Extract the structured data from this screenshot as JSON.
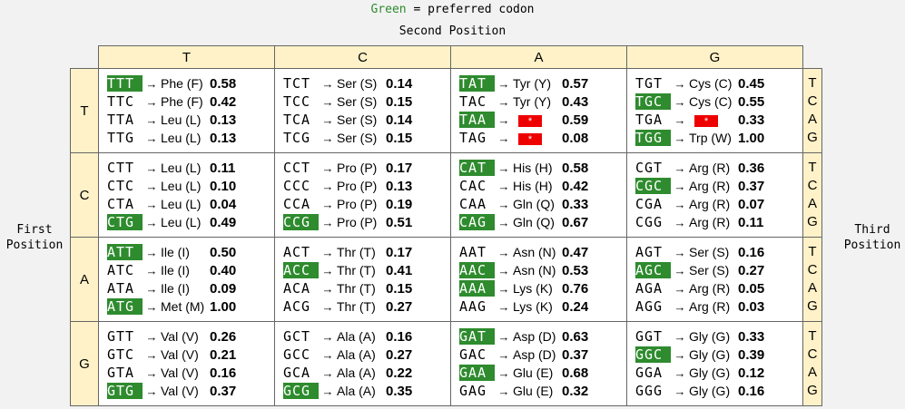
{
  "legend": {
    "green_word": "Green",
    "rest": " = preferred codon"
  },
  "second_position_label": "Second Position",
  "first_position_label": "First Position",
  "third_position_label": "Third Position",
  "columns": [
    "T",
    "C",
    "A",
    "G"
  ],
  "third_letters": [
    "T",
    "C",
    "A",
    "G"
  ],
  "rows": [
    {
      "label": "T",
      "cells": [
        [
          {
            "codon": "TTT",
            "aa": "Phe (F)",
            "freq": "0.58",
            "pref": true
          },
          {
            "codon": "TTC",
            "aa": "Phe (F)",
            "freq": "0.42",
            "pref": false
          },
          {
            "codon": "TTA",
            "aa": "Leu (L)",
            "freq": "0.13",
            "pref": false
          },
          {
            "codon": "TTG",
            "aa": "Leu (L)",
            "freq": "0.13",
            "pref": false
          }
        ],
        [
          {
            "codon": "TCT",
            "aa": "Ser (S)",
            "freq": "0.14",
            "pref": false
          },
          {
            "codon": "TCC",
            "aa": "Ser (S)",
            "freq": "0.15",
            "pref": false
          },
          {
            "codon": "TCA",
            "aa": "Ser (S)",
            "freq": "0.14",
            "pref": false
          },
          {
            "codon": "TCG",
            "aa": "Ser (S)",
            "freq": "0.15",
            "pref": false
          }
        ],
        [
          {
            "codon": "TAT",
            "aa": "Tyr (Y)",
            "freq": "0.57",
            "pref": true
          },
          {
            "codon": "TAC",
            "aa": "Tyr (Y)",
            "freq": "0.43",
            "pref": false
          },
          {
            "codon": "TAA",
            "aa": "*",
            "freq": "0.59",
            "pref": true,
            "stop": true
          },
          {
            "codon": "TAG",
            "aa": "*",
            "freq": "0.08",
            "pref": false,
            "stop": true
          }
        ],
        [
          {
            "codon": "TGT",
            "aa": "Cys (C)",
            "freq": "0.45",
            "pref": false
          },
          {
            "codon": "TGC",
            "aa": "Cys (C)",
            "freq": "0.55",
            "pref": true
          },
          {
            "codon": "TGA",
            "aa": "*",
            "freq": "0.33",
            "pref": false,
            "stop": true
          },
          {
            "codon": "TGG",
            "aa": "Trp (W)",
            "freq": "1.00",
            "pref": true
          }
        ]
      ]
    },
    {
      "label": "C",
      "cells": [
        [
          {
            "codon": "CTT",
            "aa": "Leu (L)",
            "freq": "0.11",
            "pref": false
          },
          {
            "codon": "CTC",
            "aa": "Leu (L)",
            "freq": "0.10",
            "pref": false
          },
          {
            "codon": "CTA",
            "aa": "Leu (L)",
            "freq": "0.04",
            "pref": false
          },
          {
            "codon": "CTG",
            "aa": "Leu (L)",
            "freq": "0.49",
            "pref": true
          }
        ],
        [
          {
            "codon": "CCT",
            "aa": "Pro (P)",
            "freq": "0.17",
            "pref": false
          },
          {
            "codon": "CCC",
            "aa": "Pro (P)",
            "freq": "0.13",
            "pref": false
          },
          {
            "codon": "CCA",
            "aa": "Pro (P)",
            "freq": "0.19",
            "pref": false
          },
          {
            "codon": "CCG",
            "aa": "Pro (P)",
            "freq": "0.51",
            "pref": true
          }
        ],
        [
          {
            "codon": "CAT",
            "aa": "His (H)",
            "freq": "0.58",
            "pref": true
          },
          {
            "codon": "CAC",
            "aa": "His (H)",
            "freq": "0.42",
            "pref": false
          },
          {
            "codon": "CAA",
            "aa": "Gln (Q)",
            "freq": "0.33",
            "pref": false
          },
          {
            "codon": "CAG",
            "aa": "Gln (Q)",
            "freq": "0.67",
            "pref": true
          }
        ],
        [
          {
            "codon": "CGT",
            "aa": "Arg (R)",
            "freq": "0.36",
            "pref": false
          },
          {
            "codon": "CGC",
            "aa": "Arg (R)",
            "freq": "0.37",
            "pref": true
          },
          {
            "codon": "CGA",
            "aa": "Arg (R)",
            "freq": "0.07",
            "pref": false
          },
          {
            "codon": "CGG",
            "aa": "Arg (R)",
            "freq": "0.11",
            "pref": false
          }
        ]
      ]
    },
    {
      "label": "A",
      "cells": [
        [
          {
            "codon": "ATT",
            "aa": "Ile (I)",
            "freq": "0.50",
            "pref": true
          },
          {
            "codon": "ATC",
            "aa": "Ile (I)",
            "freq": "0.40",
            "pref": false
          },
          {
            "codon": "ATA",
            "aa": "Ile (I)",
            "freq": "0.09",
            "pref": false
          },
          {
            "codon": "ATG",
            "aa": "Met (M)",
            "freq": "1.00",
            "pref": true
          }
        ],
        [
          {
            "codon": "ACT",
            "aa": "Thr (T)",
            "freq": "0.17",
            "pref": false
          },
          {
            "codon": "ACC",
            "aa": "Thr (T)",
            "freq": "0.41",
            "pref": true
          },
          {
            "codon": "ACA",
            "aa": "Thr (T)",
            "freq": "0.15",
            "pref": false
          },
          {
            "codon": "ACG",
            "aa": "Thr (T)",
            "freq": "0.27",
            "pref": false
          }
        ],
        [
          {
            "codon": "AAT",
            "aa": "Asn (N)",
            "freq": "0.47",
            "pref": false
          },
          {
            "codon": "AAC",
            "aa": "Asn (N)",
            "freq": "0.53",
            "pref": true
          },
          {
            "codon": "AAA",
            "aa": "Lys (K)",
            "freq": "0.76",
            "pref": true
          },
          {
            "codon": "AAG",
            "aa": "Lys (K)",
            "freq": "0.24",
            "pref": false
          }
        ],
        [
          {
            "codon": "AGT",
            "aa": "Ser (S)",
            "freq": "0.16",
            "pref": false
          },
          {
            "codon": "AGC",
            "aa": "Ser (S)",
            "freq": "0.27",
            "pref": true
          },
          {
            "codon": "AGA",
            "aa": "Arg (R)",
            "freq": "0.05",
            "pref": false
          },
          {
            "codon": "AGG",
            "aa": "Arg (R)",
            "freq": "0.03",
            "pref": false
          }
        ]
      ]
    },
    {
      "label": "G",
      "cells": [
        [
          {
            "codon": "GTT",
            "aa": "Val (V)",
            "freq": "0.26",
            "pref": false
          },
          {
            "codon": "GTC",
            "aa": "Val (V)",
            "freq": "0.21",
            "pref": false
          },
          {
            "codon": "GTA",
            "aa": "Val (V)",
            "freq": "0.16",
            "pref": false
          },
          {
            "codon": "GTG",
            "aa": "Val (V)",
            "freq": "0.37",
            "pref": true
          }
        ],
        [
          {
            "codon": "GCT",
            "aa": "Ala (A)",
            "freq": "0.16",
            "pref": false
          },
          {
            "codon": "GCC",
            "aa": "Ala (A)",
            "freq": "0.27",
            "pref": false
          },
          {
            "codon": "GCA",
            "aa": "Ala (A)",
            "freq": "0.22",
            "pref": false
          },
          {
            "codon": "GCG",
            "aa": "Ala (A)",
            "freq": "0.35",
            "pref": true
          }
        ],
        [
          {
            "codon": "GAT",
            "aa": "Asp (D)",
            "freq": "0.63",
            "pref": true
          },
          {
            "codon": "GAC",
            "aa": "Asp (D)",
            "freq": "0.37",
            "pref": false
          },
          {
            "codon": "GAA",
            "aa": "Glu (E)",
            "freq": "0.68",
            "pref": true
          },
          {
            "codon": "GAG",
            "aa": "Glu (E)",
            "freq": "0.32",
            "pref": false
          }
        ],
        [
          {
            "codon": "GGT",
            "aa": "Gly (G)",
            "freq": "0.33",
            "pref": false
          },
          {
            "codon": "GGC",
            "aa": "Gly (G)",
            "freq": "0.39",
            "pref": true
          },
          {
            "codon": "GGA",
            "aa": "Gly (G)",
            "freq": "0.12",
            "pref": false
          },
          {
            "codon": "GGG",
            "aa": "Gly (G)",
            "freq": "0.16",
            "pref": false
          }
        ]
      ]
    }
  ],
  "colors": {
    "preferred": "#2e8b2e",
    "header_bg": "#fff2c8",
    "stop": "#e00000"
  }
}
